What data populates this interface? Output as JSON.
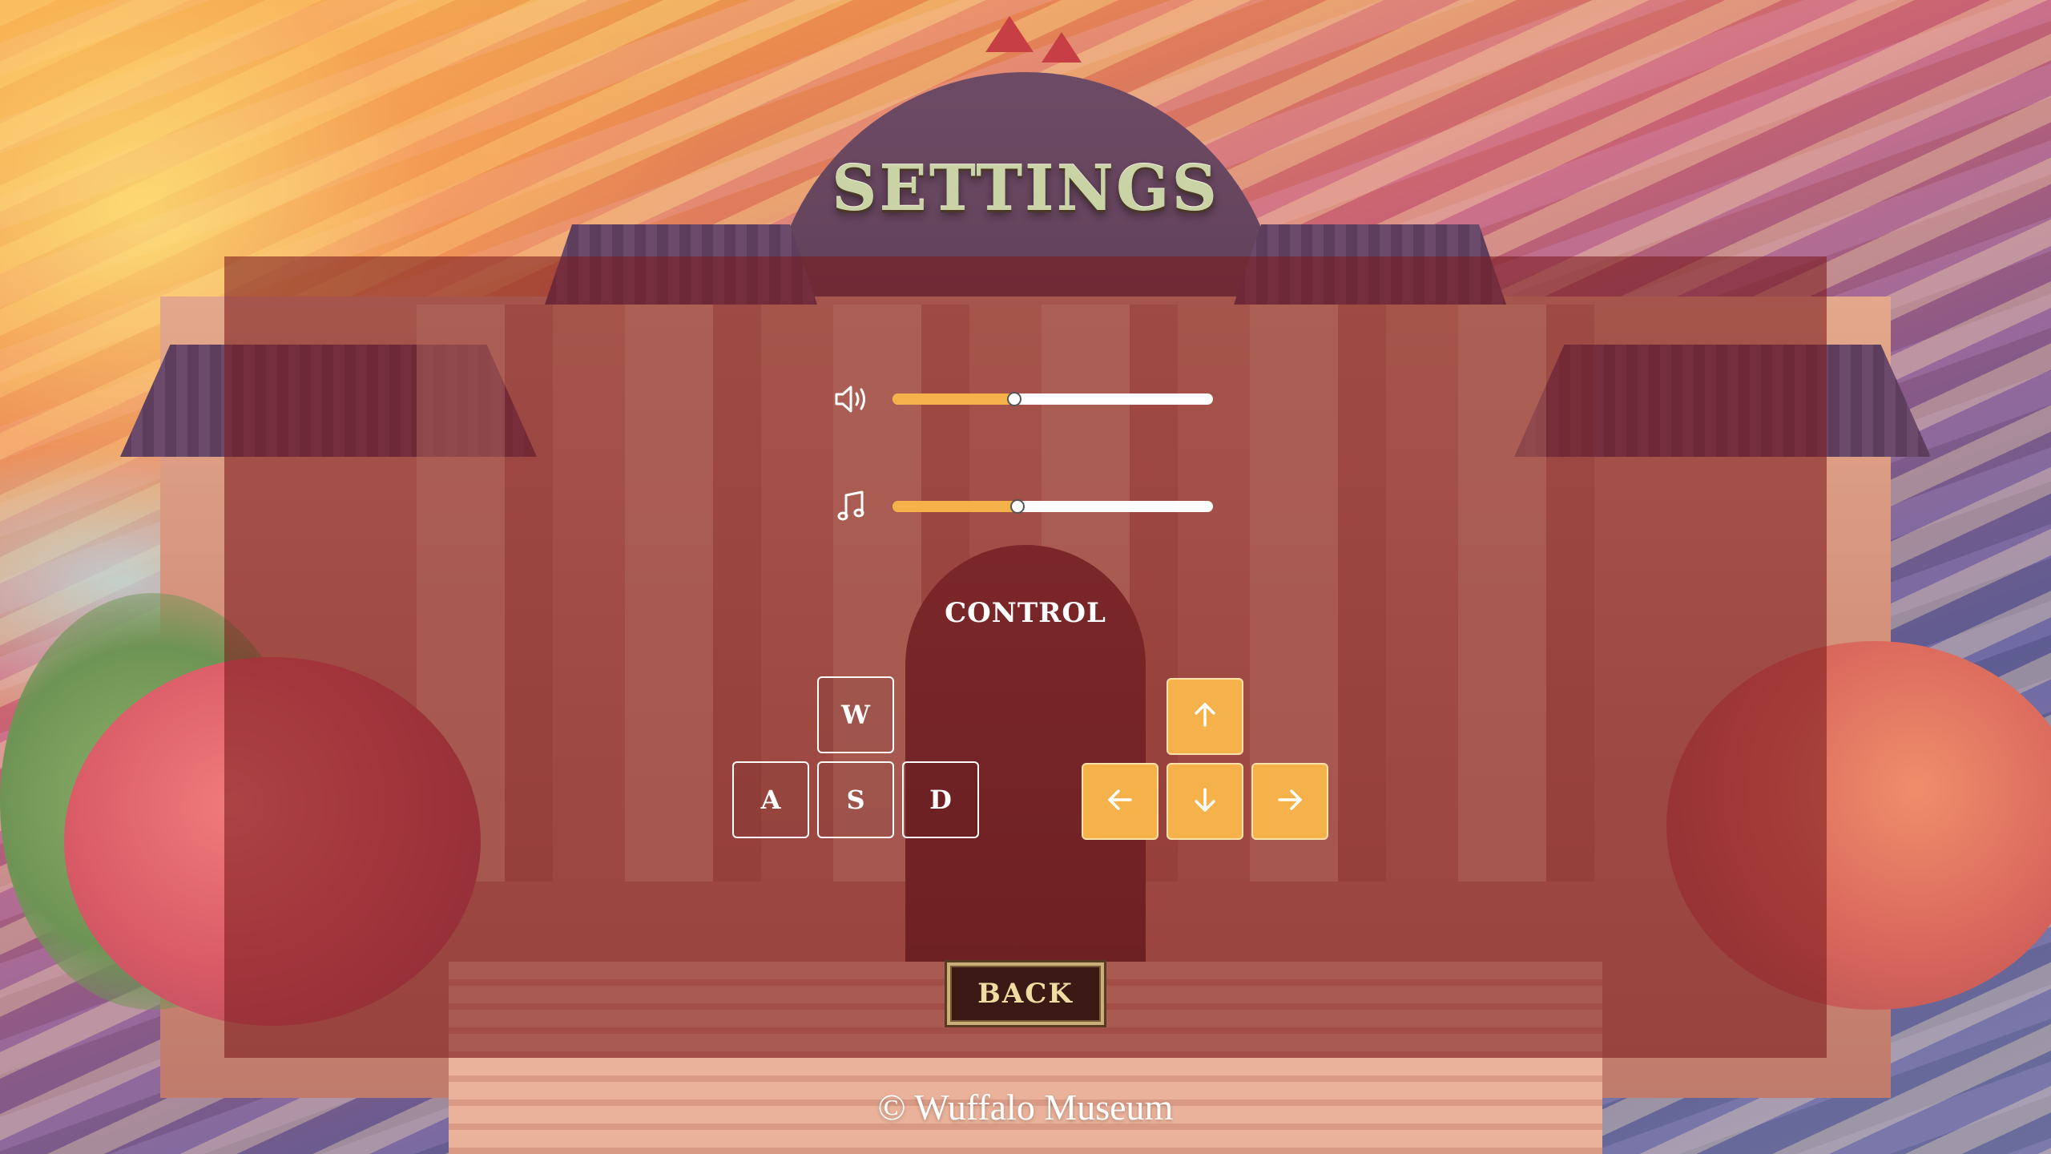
{
  "title": "SETTINGS",
  "audio": {
    "volume": {
      "icon": "speaker-volume-icon",
      "level": 0.38
    },
    "music": {
      "icon": "music-note-icon",
      "level": 0.39
    }
  },
  "controls": {
    "heading": "CONTROL",
    "wasd": {
      "up": "W",
      "left": "A",
      "down": "S",
      "right": "D"
    },
    "arrows": [
      "arrow-up-icon",
      "arrow-left-icon",
      "arrow-down-icon",
      "arrow-right-icon"
    ]
  },
  "back_label": "BACK",
  "footer": "© Wuffalo Museum",
  "colors": {
    "accent": "#f5b24a",
    "panel": "#7a1a1e",
    "title": "#c9d3a6",
    "button_text": "#eedca0"
  }
}
